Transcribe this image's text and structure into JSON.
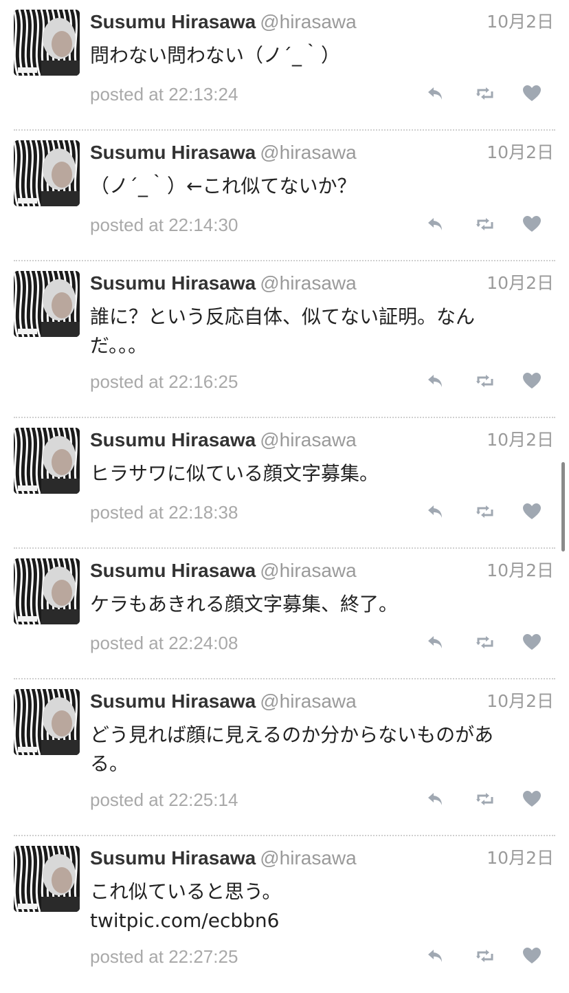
{
  "colors": {
    "text": "#222222",
    "muted": "#a9a9a9",
    "icon": "#a0a8b2",
    "separator": "#cfcfcf"
  },
  "icons": {
    "reply": "reply-icon",
    "retweet": "retweet-icon",
    "favorite": "heart-icon"
  },
  "tweets": [
    {
      "name": "Susumu Hirasawa",
      "handle": "@hirasawa",
      "date": "10月2日",
      "text": "問わない問わない（ノ´_｀）",
      "posted": "posted at 22:13:24"
    },
    {
      "name": "Susumu Hirasawa",
      "handle": "@hirasawa",
      "date": "10月2日",
      "text": "（ノ´_｀）←これ似てないか？",
      "posted": "posted at 22:14:30"
    },
    {
      "name": "Susumu Hirasawa",
      "handle": "@hirasawa",
      "date": "10月2日",
      "text": "誰に？という反応自体、似てない証明。なん\nだ。。。",
      "posted": "posted at 22:16:25"
    },
    {
      "name": "Susumu Hirasawa",
      "handle": "@hirasawa",
      "date": "10月2日",
      "text": "ヒラサワに似ている顔文字募集。",
      "posted": "posted at 22:18:38"
    },
    {
      "name": "Susumu Hirasawa",
      "handle": "@hirasawa",
      "date": "10月2日",
      "text": "ケラもあきれる顔文字募集、終了。",
      "posted": "posted at 22:24:08"
    },
    {
      "name": "Susumu Hirasawa",
      "handle": "@hirasawa",
      "date": "10月2日",
      "text": "どう見れば顔に見えるのか分からないものがあ\nる。",
      "posted": "posted at 22:25:14"
    },
    {
      "name": "Susumu Hirasawa",
      "handle": "@hirasawa",
      "date": "10月2日",
      "text": "これ似ていると思う。",
      "link": "twitpic.com/ecbbn6",
      "posted": "posted at 22:27:25"
    }
  ]
}
